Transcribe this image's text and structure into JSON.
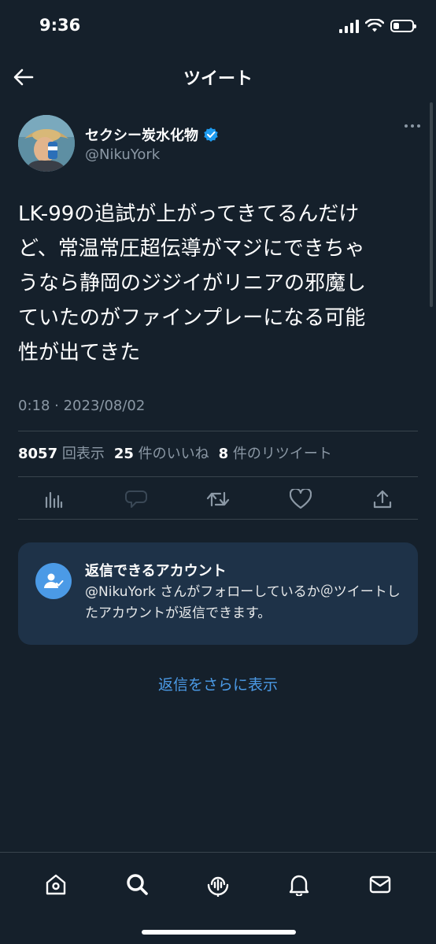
{
  "status_bar": {
    "time": "9:36",
    "battery_level": 0.3
  },
  "nav": {
    "title": "ツイート"
  },
  "tweet": {
    "display_name": "セクシー炭水化物",
    "username": "@NikuYork",
    "verified": true,
    "text": "LK-99の追試が上がってきてるんだけ\nど、常温常圧超伝導がマジにできちゃ\nうなら静岡のジジイがリニアの邪魔し\nていたのがファインプレーになる可能\n性が出てきた",
    "timestamp": "0:18 · 2023/08/02",
    "stats": {
      "views_count": "8057",
      "views_label": "回表示",
      "likes_count": "25",
      "likes_label": "件のいいね",
      "retweets_count": "8",
      "retweets_label": "件のリツイート"
    }
  },
  "actions": [
    "bar-chart-icon",
    "reply-icon",
    "retweet-icon",
    "heart-icon",
    "share-icon"
  ],
  "reply_notice": {
    "title": "返信できるアカウント",
    "body": "@NikuYork さんがフォローしているか＠ツイートしたアカウントが返信できます。"
  },
  "show_more_replies": "返信をさらに表示",
  "tab_bar": [
    "home-icon",
    "search-icon",
    "spaces-icon",
    "notifications-icon",
    "messages-icon"
  ],
  "colors": {
    "background": "#15202b",
    "accent": "#4b9ae6",
    "secondary_text": "#8b98a5",
    "verified": "#1d9bf0",
    "card": "#1e3248"
  }
}
